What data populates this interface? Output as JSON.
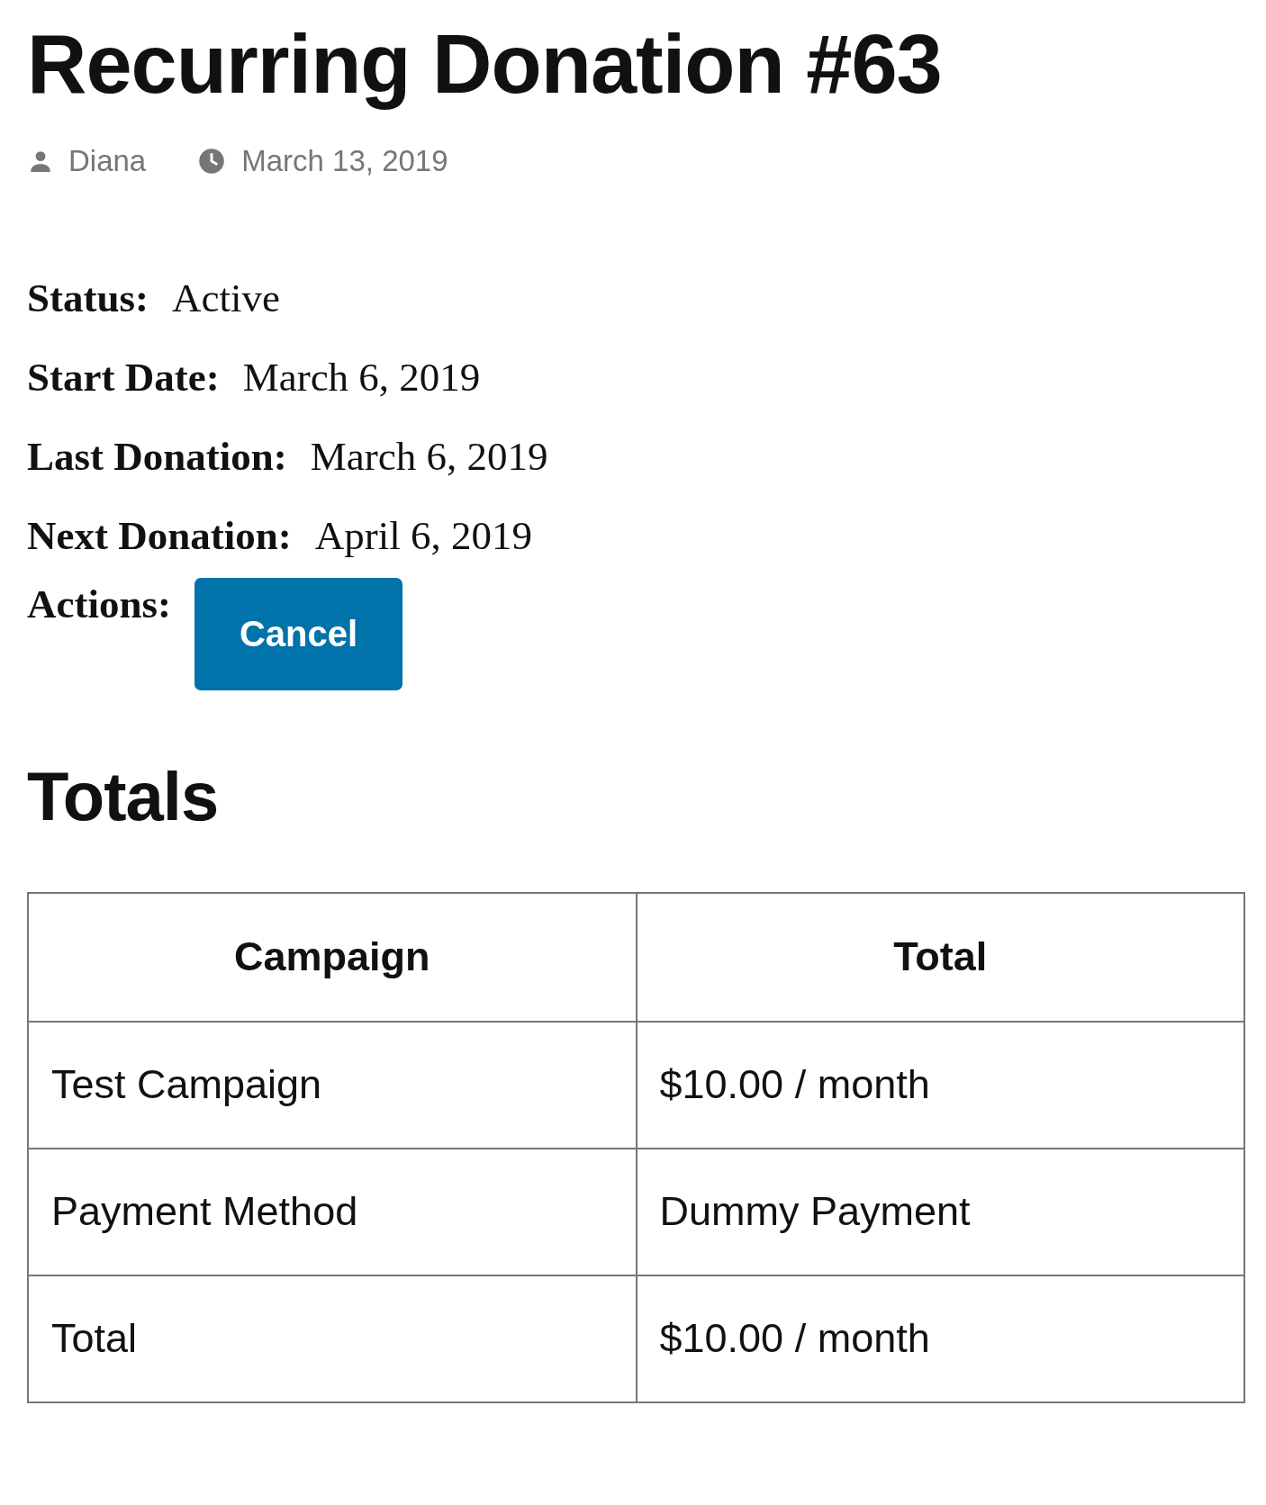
{
  "title": "Recurring Donation #63",
  "meta": {
    "author": "Diana",
    "date": "March 13, 2019"
  },
  "details": [
    {
      "label": "Status:",
      "value": "Active"
    },
    {
      "label": "Start Date:",
      "value": "March 6, 2019"
    },
    {
      "label": "Last Donation:",
      "value": "March 6, 2019"
    },
    {
      "label": "Next Donation:",
      "value": "April 6, 2019"
    }
  ],
  "actions": {
    "label": "Actions:",
    "buttons": [
      "Cancel"
    ]
  },
  "totals": {
    "heading": "Totals",
    "columns": [
      "Campaign",
      "Total"
    ],
    "rows": [
      [
        "Test Campaign",
        "$10.00 / month"
      ],
      [
        "Payment Method",
        "Dummy Payment"
      ],
      [
        "Total",
        "$10.00 / month"
      ]
    ]
  }
}
